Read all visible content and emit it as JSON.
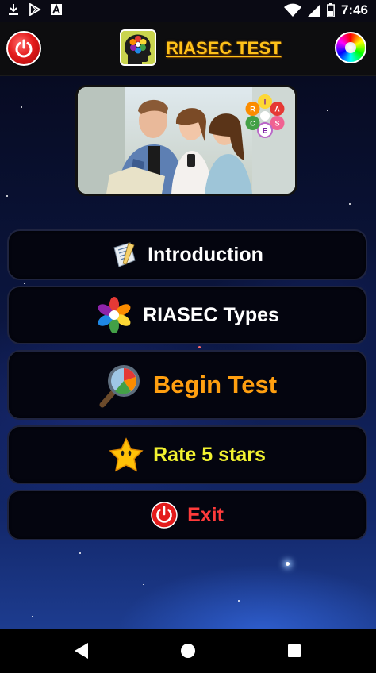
{
  "status_bar": {
    "time": "7:46",
    "left_icons": [
      "download-icon",
      "play-store-icon",
      "a-notification-icon"
    ],
    "right_icons": [
      "wifi-icon",
      "signal-icon",
      "battery-icon"
    ]
  },
  "app_bar": {
    "title": "RIASEC TEST",
    "title_color": "#ffc21a",
    "power_icon": "power-icon",
    "theme_icon": "color-wheel-icon"
  },
  "hero": {
    "badge_letters": [
      "R",
      "I",
      "A",
      "S",
      "E",
      "C"
    ]
  },
  "menu": [
    {
      "id": "introduction",
      "label": "Introduction",
      "icon": "notepad-icon",
      "color": "#ffffff"
    },
    {
      "id": "riasec-types",
      "label": "RIASEC Types",
      "icon": "flower-icon",
      "color": "#ffffff"
    },
    {
      "id": "begin-test",
      "label": "Begin Test",
      "icon": "magnifier-chart-icon",
      "color": "#ff9f10"
    },
    {
      "id": "rate",
      "label": "Rate 5 stars",
      "icon": "star-icon",
      "color": "#f2f230"
    },
    {
      "id": "exit",
      "label": "Exit",
      "icon": "power-icon",
      "color": "#ff3b3b"
    }
  ],
  "nav_bar": {
    "items": [
      "back-icon",
      "home-icon",
      "recents-icon"
    ]
  }
}
